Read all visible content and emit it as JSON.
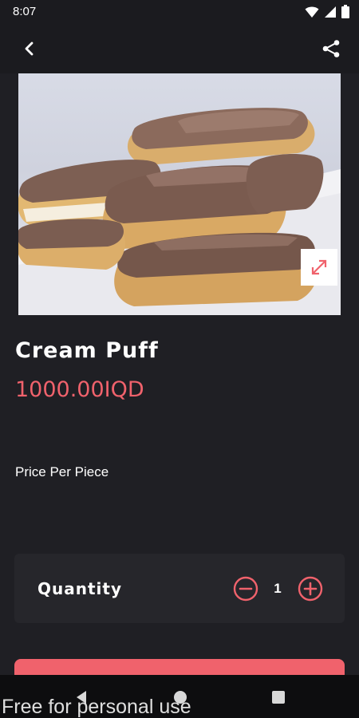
{
  "status_bar": {
    "time": "8:07",
    "icons": [
      "wifi-icon",
      "signal-icon",
      "battery-icon"
    ]
  },
  "app_bar": {
    "back_icon": "chevron-left-icon",
    "share_icon": "share-icon"
  },
  "product": {
    "image_alt": "Chocolate-glazed eclairs on a white plate",
    "expand_icon": "expand-arrows-icon",
    "title": "Cream Puff",
    "price": "1000.00IQD",
    "price_note": "Price Per Piece"
  },
  "quantity": {
    "label": "Quantity",
    "value": "1",
    "minus_icon": "minus-circle-icon",
    "plus_icon": "plus-circle-icon"
  },
  "nav_bar": {
    "back_icon": "nav-back-icon",
    "home_icon": "nav-home-icon",
    "recents_icon": "nav-recents-icon"
  },
  "watermark": "Free for personal use",
  "colors": {
    "background": "#1f1f24",
    "accent": "#f0626c",
    "card": "#26262b",
    "bar": "#1b1b1f"
  }
}
